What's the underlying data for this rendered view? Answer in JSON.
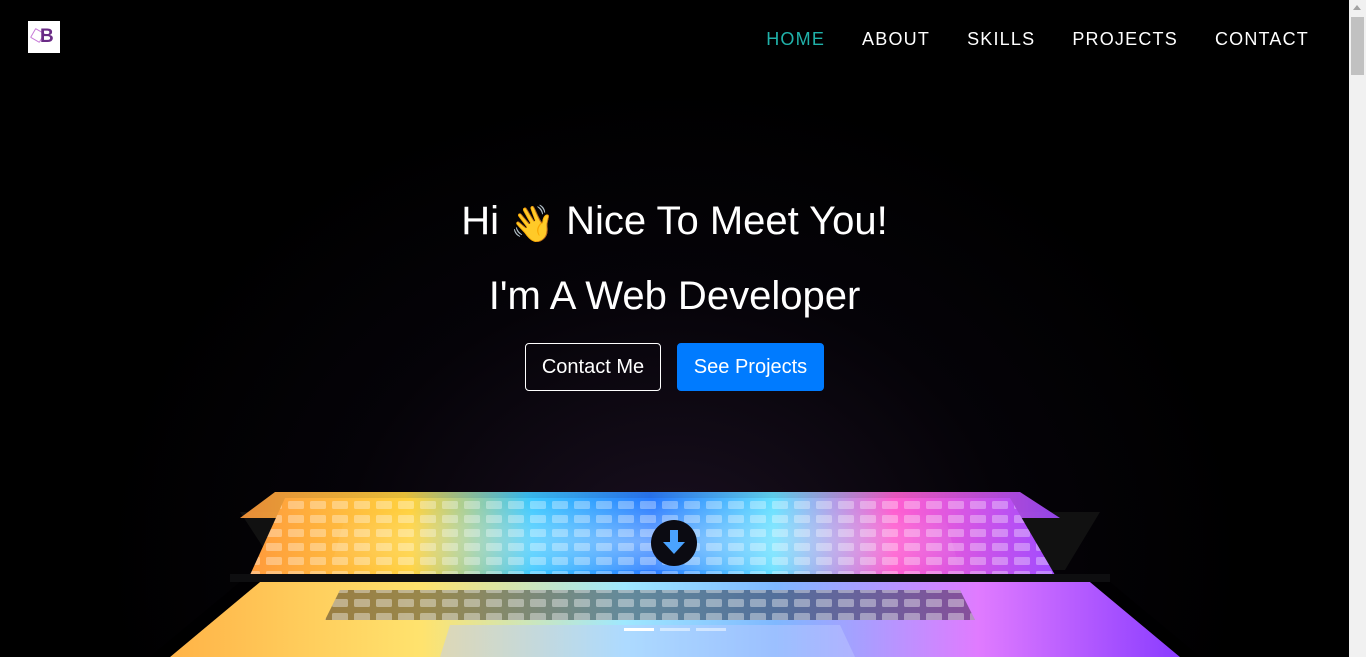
{
  "nav": {
    "logo_letter": "B",
    "links": [
      {
        "label": "HOME",
        "active": true
      },
      {
        "label": "ABOUT",
        "active": false
      },
      {
        "label": "SKILLS",
        "active": false
      },
      {
        "label": "PROJECTS",
        "active": false
      },
      {
        "label": "CONTACT",
        "active": false
      }
    ],
    "active_color": "#20b2aa"
  },
  "hero": {
    "greeting_before": "Hi",
    "wave_emoji": "👋",
    "greeting_after": "Nice To Meet You!",
    "role": "I'm A Web Developer",
    "contact_button": "Contact Me",
    "projects_button": "See Projects",
    "primary_color": "#007bff"
  },
  "scroll_icon": "arrow-down-circle-icon",
  "carousel": {
    "slide_count": 3,
    "active_index": 0
  }
}
